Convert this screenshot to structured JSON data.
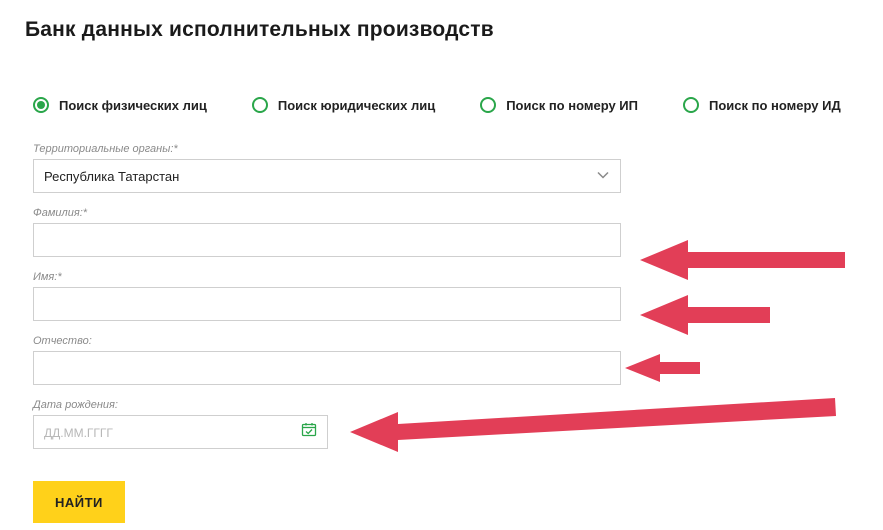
{
  "page": {
    "title": "Банк данных исполнительных производств"
  },
  "tabs": [
    {
      "label": "Поиск физических лиц",
      "selected": true
    },
    {
      "label": "Поиск юридических лиц",
      "selected": false
    },
    {
      "label": "Поиск по номеру ИП",
      "selected": false
    },
    {
      "label": "Поиск по номеру ИД",
      "selected": false
    }
  ],
  "form": {
    "territory": {
      "label": "Территориальные органы:*",
      "value": "Республика Татарстан"
    },
    "last_name": {
      "label": "Фамилия:*",
      "value": ""
    },
    "first_name": {
      "label": "Имя:*",
      "value": ""
    },
    "patronymic": {
      "label": "Отчество:",
      "value": ""
    },
    "birth_date": {
      "label": "Дата рождения:",
      "placeholder": "ДД.ММ.ГГГГ",
      "value": ""
    },
    "submit_label": "НАЙТИ"
  },
  "colors": {
    "accent_green": "#2aa64a",
    "button_yellow": "#ffd11a",
    "arrow_red": "#e23e57"
  }
}
